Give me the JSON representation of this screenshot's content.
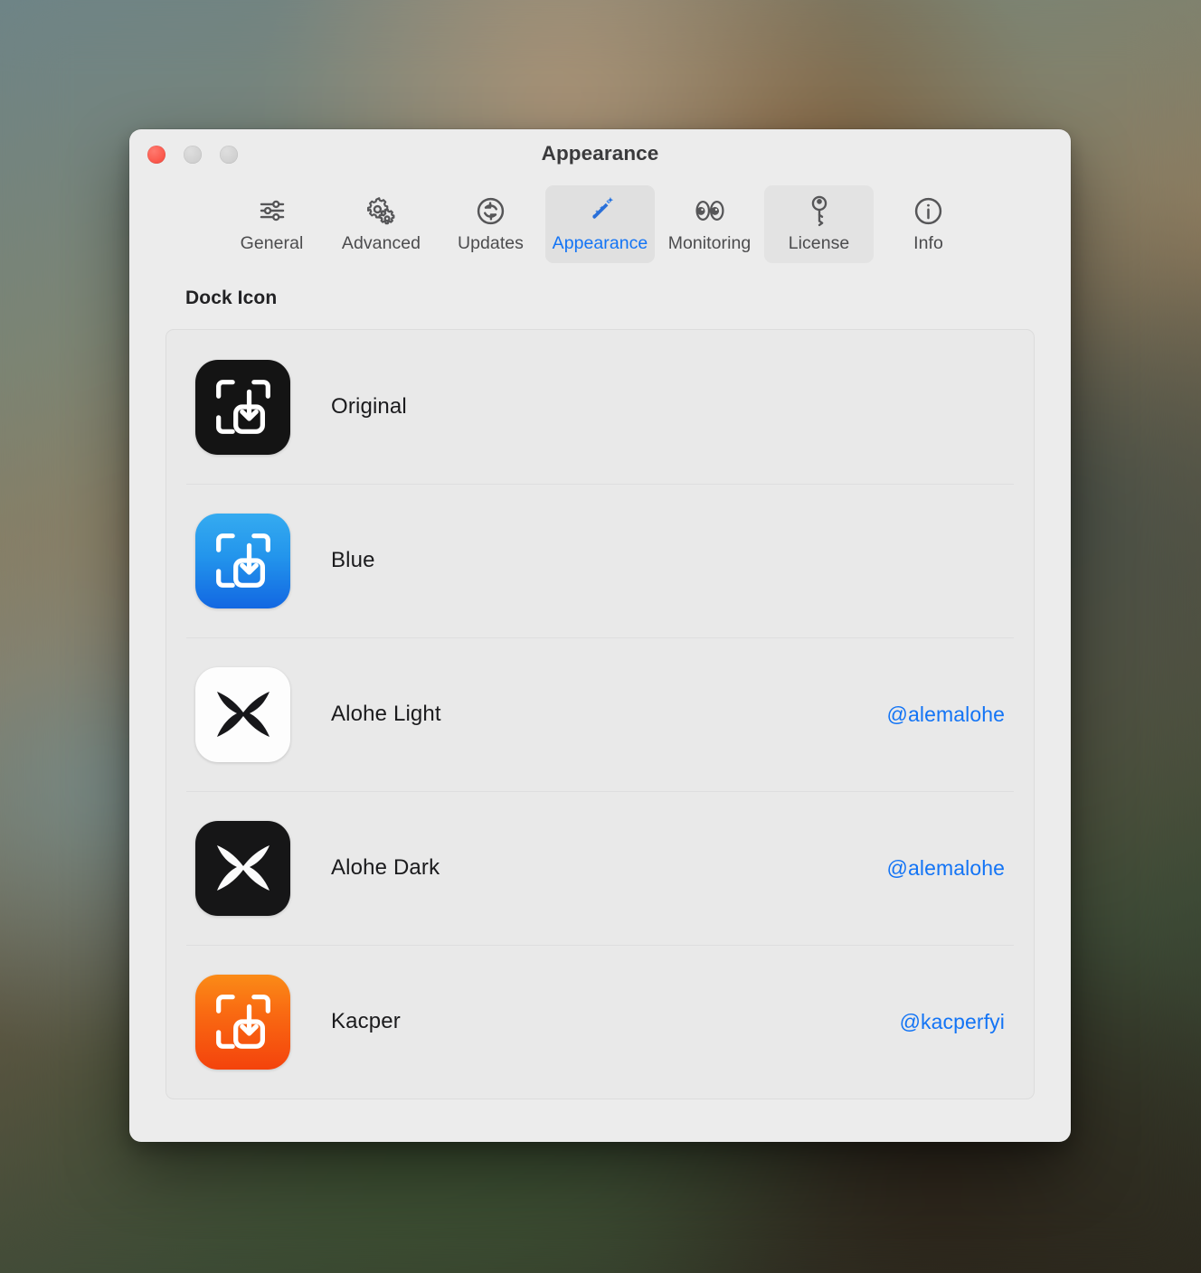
{
  "window": {
    "title": "Appearance",
    "traffic_lights": [
      {
        "name": "close",
        "color": "#fb5a4e"
      },
      {
        "name": "minimize",
        "color": "#d2d2d2"
      },
      {
        "name": "maximize",
        "color": "#d2d2d2"
      }
    ]
  },
  "toolbar": {
    "tabs": [
      {
        "label": "General",
        "icon": "sliders-icon",
        "state": "normal"
      },
      {
        "label": "Advanced",
        "icon": "gears-icon",
        "state": "normal"
      },
      {
        "label": "Updates",
        "icon": "refresh-icon",
        "state": "normal"
      },
      {
        "label": "Appearance",
        "icon": "magic-wand-icon",
        "state": "selected"
      },
      {
        "label": "Monitoring",
        "icon": "eyes-icon",
        "state": "normal"
      },
      {
        "label": "License",
        "icon": "key-icon",
        "state": "hovered"
      },
      {
        "label": "Info",
        "icon": "info-icon",
        "state": "normal"
      }
    ],
    "selected_color": "#1374f5"
  },
  "main": {
    "section_title": "Dock Icon",
    "link_color": "#1374f5",
    "dock_icons": [
      {
        "label": "Original",
        "credit": "",
        "icon": "capture-download-icon",
        "theme": "theme-original",
        "glyph_color": "#ffffff"
      },
      {
        "label": "Blue",
        "credit": "",
        "icon": "capture-download-icon",
        "theme": "theme-blue",
        "glyph_color": "#ffffff"
      },
      {
        "label": "Alohe Light",
        "credit": "@alemalohe",
        "icon": "alohe-mark-icon",
        "theme": "theme-white",
        "glyph_color": "#17171a"
      },
      {
        "label": "Alohe Dark",
        "credit": "@alemalohe",
        "icon": "alohe-mark-icon",
        "theme": "theme-black",
        "glyph_color": "#fbfbfb"
      },
      {
        "label": "Kacper",
        "credit": "@kacperfyi",
        "icon": "capture-download-icon",
        "theme": "theme-orange",
        "glyph_color": "#ffffff"
      }
    ]
  }
}
